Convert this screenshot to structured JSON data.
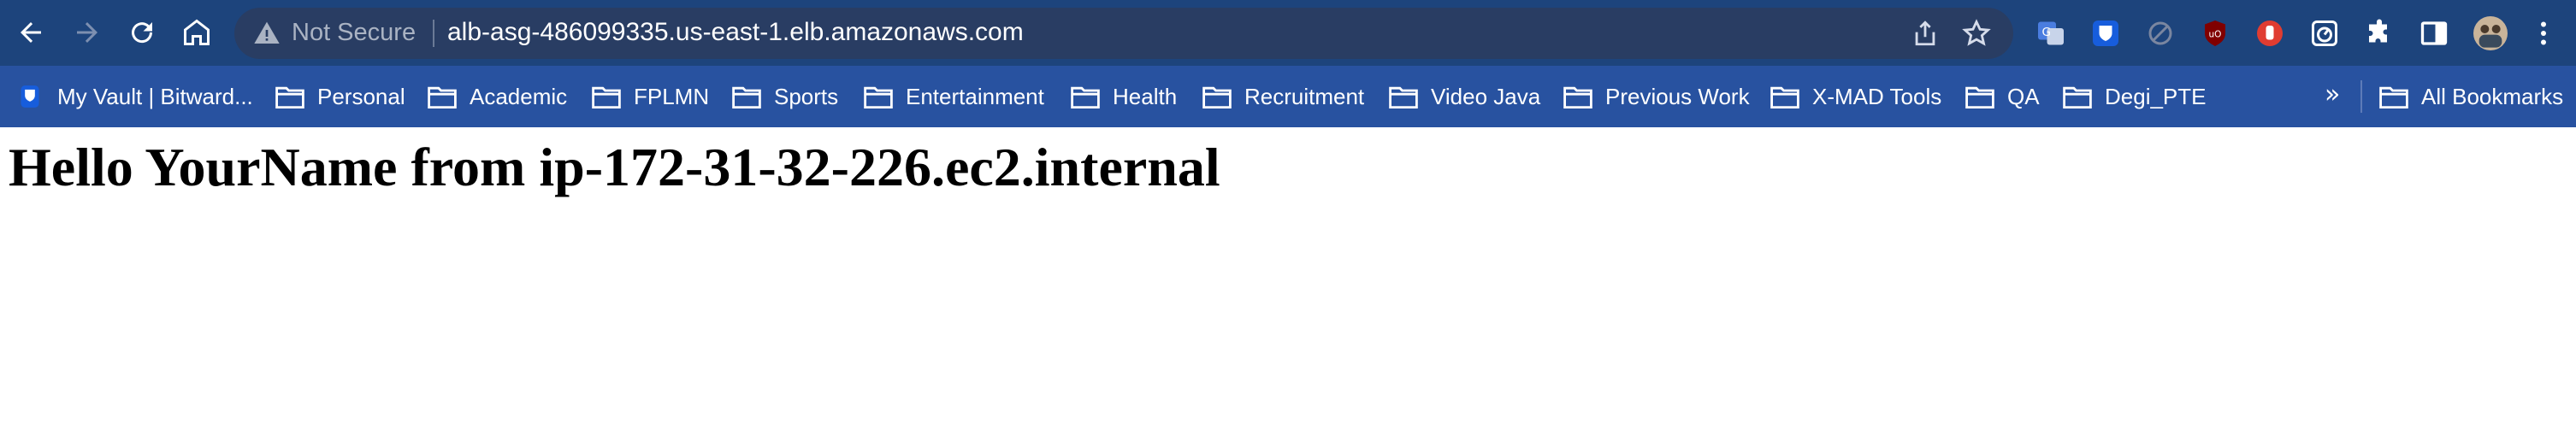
{
  "browser": {
    "security_label": "Not Secure",
    "url": "alb-asg-486099335.us-east-1.elb.amazonaws.com"
  },
  "extensions": [
    "google-translate-icon",
    "bitwarden-icon",
    "tracker-icon",
    "ublock-icon",
    "stop-hand-icon",
    "gauge-icon",
    "puzzle-icon"
  ],
  "bookmarks": {
    "items": [
      {
        "label": "My Vault | Bitward...",
        "icon": "bitwarden-icon"
      },
      {
        "label": "Personal",
        "icon": "folder-icon"
      },
      {
        "label": "Academic",
        "icon": "folder-icon"
      },
      {
        "label": "FPLMN",
        "icon": "folder-icon"
      },
      {
        "label": "Sports",
        "icon": "folder-icon"
      },
      {
        "label": "Entertainment",
        "icon": "folder-icon"
      },
      {
        "label": "Health",
        "icon": "folder-icon"
      },
      {
        "label": "Recruitment",
        "icon": "folder-icon"
      },
      {
        "label": "Video Java",
        "icon": "folder-icon"
      },
      {
        "label": "Previous Work",
        "icon": "folder-icon"
      },
      {
        "label": "X-MAD Tools",
        "icon": "folder-icon"
      },
      {
        "label": "QA",
        "icon": "folder-icon"
      },
      {
        "label": "Degi_PTE",
        "icon": "folder-icon"
      }
    ],
    "overflow_label": "»",
    "all_bookmarks_label": "All Bookmarks"
  },
  "page": {
    "heading": "Hello YourName from ip-172-31-32-226.ec2.internal"
  },
  "colors": {
    "toolbar": "#1d447c",
    "omnibox": "#293d63",
    "bookmarks_bar": "#2852a0",
    "page_bg": "#ffffff"
  }
}
